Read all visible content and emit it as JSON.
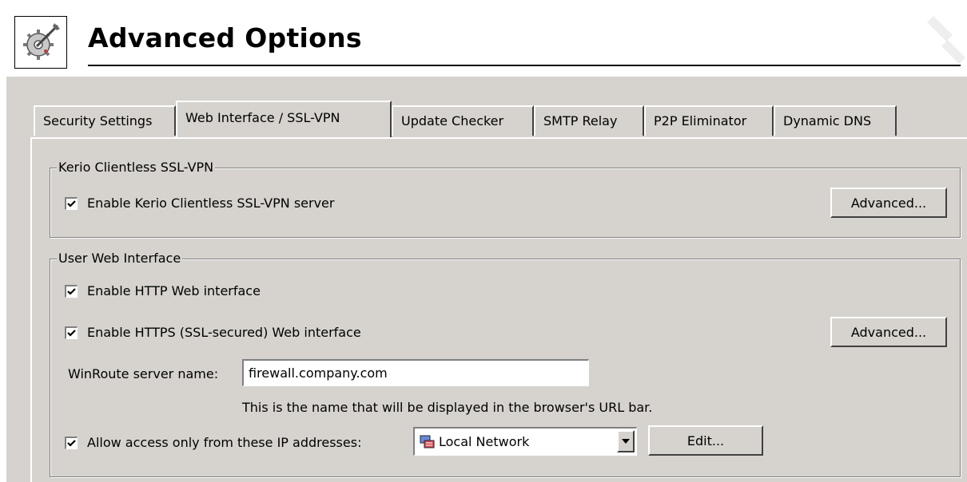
{
  "header": {
    "title": "Advanced Options",
    "icon": "gear-wrench-icon"
  },
  "tabs": [
    {
      "label": "Security Settings",
      "active": false
    },
    {
      "label": "Web Interface / SSL-VPN",
      "active": true
    },
    {
      "label": "Update Checker",
      "active": false
    },
    {
      "label": "SMTP Relay",
      "active": false
    },
    {
      "label": "P2P Eliminator",
      "active": false
    },
    {
      "label": "Dynamic DNS",
      "active": false
    }
  ],
  "ssl_vpn": {
    "legend": "Kerio Clientless SSL-VPN",
    "enable_label": "Enable Kerio Clientless SSL-VPN server",
    "enable_checked": true,
    "advanced_label": "Advanced..."
  },
  "web_interface": {
    "legend": "User Web Interface",
    "http_label": "Enable HTTP Web interface",
    "http_checked": true,
    "https_label": "Enable HTTPS (SSL-secured) Web interface",
    "https_checked": true,
    "advanced_label": "Advanced...",
    "server_name_label": "WinRoute server name:",
    "server_name_value": "firewall.company.com",
    "server_name_hint": "This is the name that will be displayed in the browser's URL bar.",
    "allow_label": "Allow access only from these IP addresses:",
    "allow_checked": true,
    "ip_group_value": "Local Network",
    "edit_label": "Edit..."
  },
  "colors": {
    "dialog_bg": "#d6d3ce",
    "header_bg": "#ffffff"
  }
}
